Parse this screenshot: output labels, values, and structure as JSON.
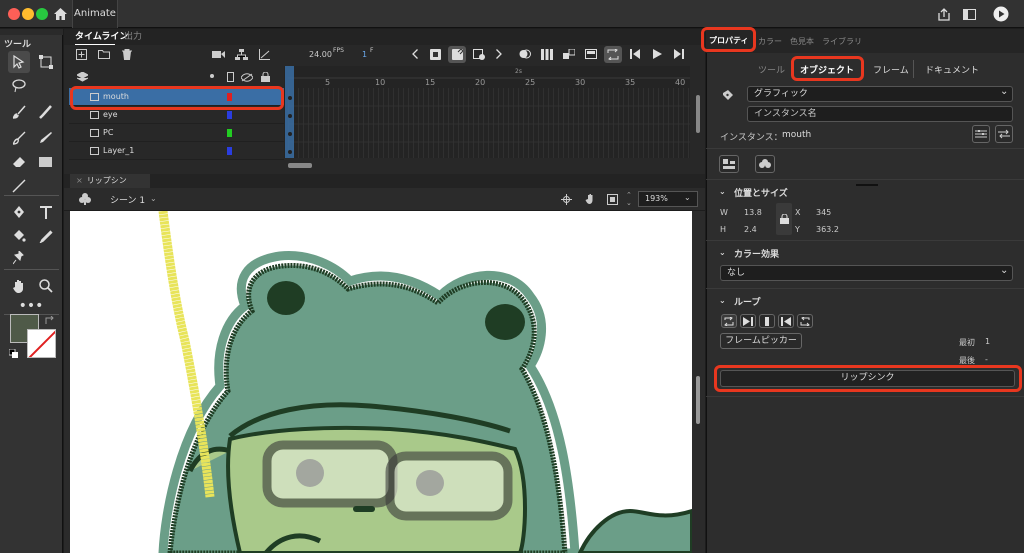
{
  "titlebar": {
    "app_tab": "Animate"
  },
  "tools": {
    "label": "ツール",
    "fill_color": "#4f5a48"
  },
  "timeline": {
    "tab_timeline": "タイムライン",
    "tab_output": "出力",
    "fps": "24.00",
    "fps_unit": "FPS",
    "frame": "1",
    "frame_unit": "F",
    "ruler_second": "2s",
    "ruler_numbers": [
      "5",
      "10",
      "15",
      "20",
      "25",
      "30",
      "35",
      "40"
    ],
    "layers": [
      {
        "name": "mouth",
        "color": "#e02020",
        "selected": true
      },
      {
        "name": "eye",
        "color": "#2a3de0"
      },
      {
        "name": "PC",
        "color": "#22cc22"
      },
      {
        "name": "Layer_1",
        "color": "#2a3de0"
      }
    ]
  },
  "document": {
    "tab": "リップシンク.fla*",
    "scene": "シーン 1",
    "zoom": "193%"
  },
  "properties": {
    "tab_properties": "プロパティ",
    "tab_color": "カラー",
    "tab_swatches": "色見本",
    "tab_library": "ライブラリ",
    "sub_tools": "ツール",
    "sub_object": "オブジェクト",
    "sub_frame": "フレーム",
    "sub_document": "ドキュメント",
    "symbol_type": "グラフィック",
    "instance_name_placeholder": "インスタンス名",
    "instance_label": "インスタンス：",
    "instance_value": "mouth",
    "pos_size": {
      "header": "位置とサイズ",
      "w_label": "W",
      "w": "13.8",
      "h_label": "H",
      "h": "2.4",
      "x_label": "X",
      "x": "345",
      "y_label": "Y",
      "y": "363.2"
    },
    "color_effect": {
      "header": "カラー効果",
      "value": "なし"
    },
    "loop": {
      "header": "ループ",
      "frame_picker": "フレームピッカー",
      "first_label": "最初",
      "first": "1",
      "last_label": "最後",
      "last": "-",
      "lip_sync": "リップシンク"
    }
  }
}
